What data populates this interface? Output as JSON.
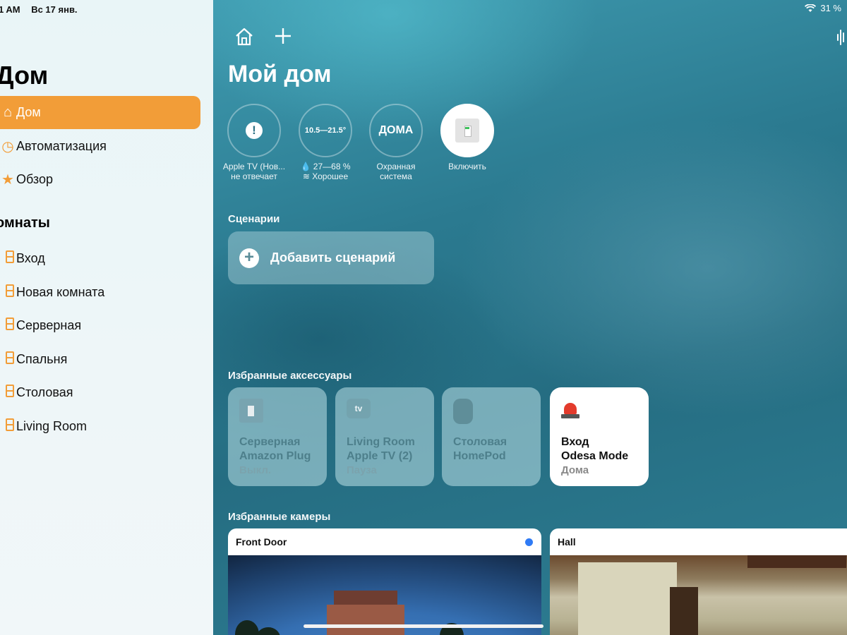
{
  "status_bar": {
    "time": "1 AM",
    "date": "Вс 17 янв.",
    "battery": "31 %"
  },
  "sidebar": {
    "title": "Дом",
    "nav": [
      {
        "label": "Дом",
        "icon": "house-icon",
        "active": true
      },
      {
        "label": "Автоматизация",
        "icon": "clock-icon",
        "active": false
      },
      {
        "label": "Обзор",
        "icon": "star-icon",
        "active": false
      }
    ],
    "rooms_header": "омнаты",
    "rooms": [
      "Вход",
      "Новая комната",
      "Серверная",
      "Спальня",
      "Столовая",
      "Living Room"
    ]
  },
  "main": {
    "title": "Мой дом",
    "status_tiles": [
      {
        "line1": "Apple TV (Нов...",
        "line2": "не отвечает",
        "icon": "alert-icon"
      },
      {
        "center": "10.5—21.5°",
        "line1": "27—68 %",
        "line2": "Хорошее",
        "icon": "thermometer-icon"
      },
      {
        "center": "ДОМА",
        "line1": "Охранная",
        "line2": "система",
        "icon": "security-icon"
      },
      {
        "line1": "Включить",
        "icon": "plug-icon"
      }
    ],
    "scenes_header": "Сценарии",
    "add_scene": "Добавить сценарий",
    "accessories_header": "Избранные аксессуары",
    "accessories": [
      {
        "room": "Серверная",
        "name": "Amazon Plug",
        "state": "Выкл.",
        "icon": "plug-icon",
        "on": false
      },
      {
        "room": "Living Room",
        "name": "Apple TV (2)",
        "state": "Пауза",
        "icon": "apple-tv-icon",
        "on": false
      },
      {
        "room": "Столовая",
        "name": "HomePod",
        "state": "",
        "icon": "homepod-icon",
        "on": false
      },
      {
        "room": "Вход",
        "name": "Odesa Mode",
        "state": "Дома",
        "icon": "siren-icon",
        "on": true
      }
    ],
    "cameras_header": "Избранные камеры",
    "cameras": [
      {
        "name": "Front Door",
        "live": true
      },
      {
        "name": "Hall",
        "live": false
      }
    ],
    "colors": {
      "accent": "#f29d38",
      "live_dot": "#2f7bf5"
    }
  }
}
